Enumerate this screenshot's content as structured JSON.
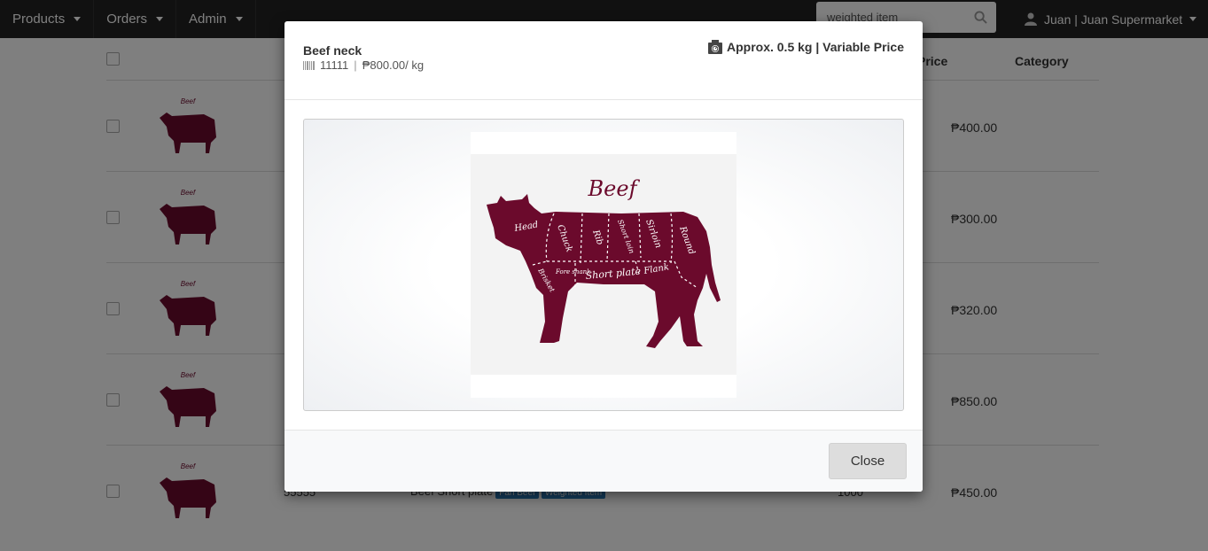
{
  "navbar": {
    "products_label": "Products",
    "orders_label": "Orders",
    "admin_label": "Admin",
    "search_value": "weighted item",
    "user_label": "Juan | Juan Supermarket"
  },
  "table": {
    "headers": {
      "price": "Price",
      "category": "Category"
    },
    "rows": [
      {
        "price": "₱400.00"
      },
      {
        "price": "₱300.00"
      },
      {
        "price": "₱320.00"
      },
      {
        "price": "₱850.00"
      },
      {
        "sku": "55555",
        "name": "Beef Short plate",
        "badge1": "Fan Beef",
        "badge2": "Weighted Item",
        "qty": "1000",
        "price": "₱450.00"
      }
    ]
  },
  "modal": {
    "title": "Beef neck",
    "sku": "11111",
    "price_per_unit": "₱800.00/ kg",
    "approx_label": "Approx. 0.5 kg | Variable Price",
    "close_label": "Close",
    "image": {
      "title": "Beef",
      "cut_labels": [
        "Head",
        "Chuck",
        "Rib",
        "Short loin",
        "Sirloin",
        "Round",
        "Brisket",
        "Fore shank",
        "Short plate",
        "Flank"
      ]
    }
  },
  "colors": {
    "beef_accent": "#6b0a2c",
    "navbar": "#222222"
  }
}
